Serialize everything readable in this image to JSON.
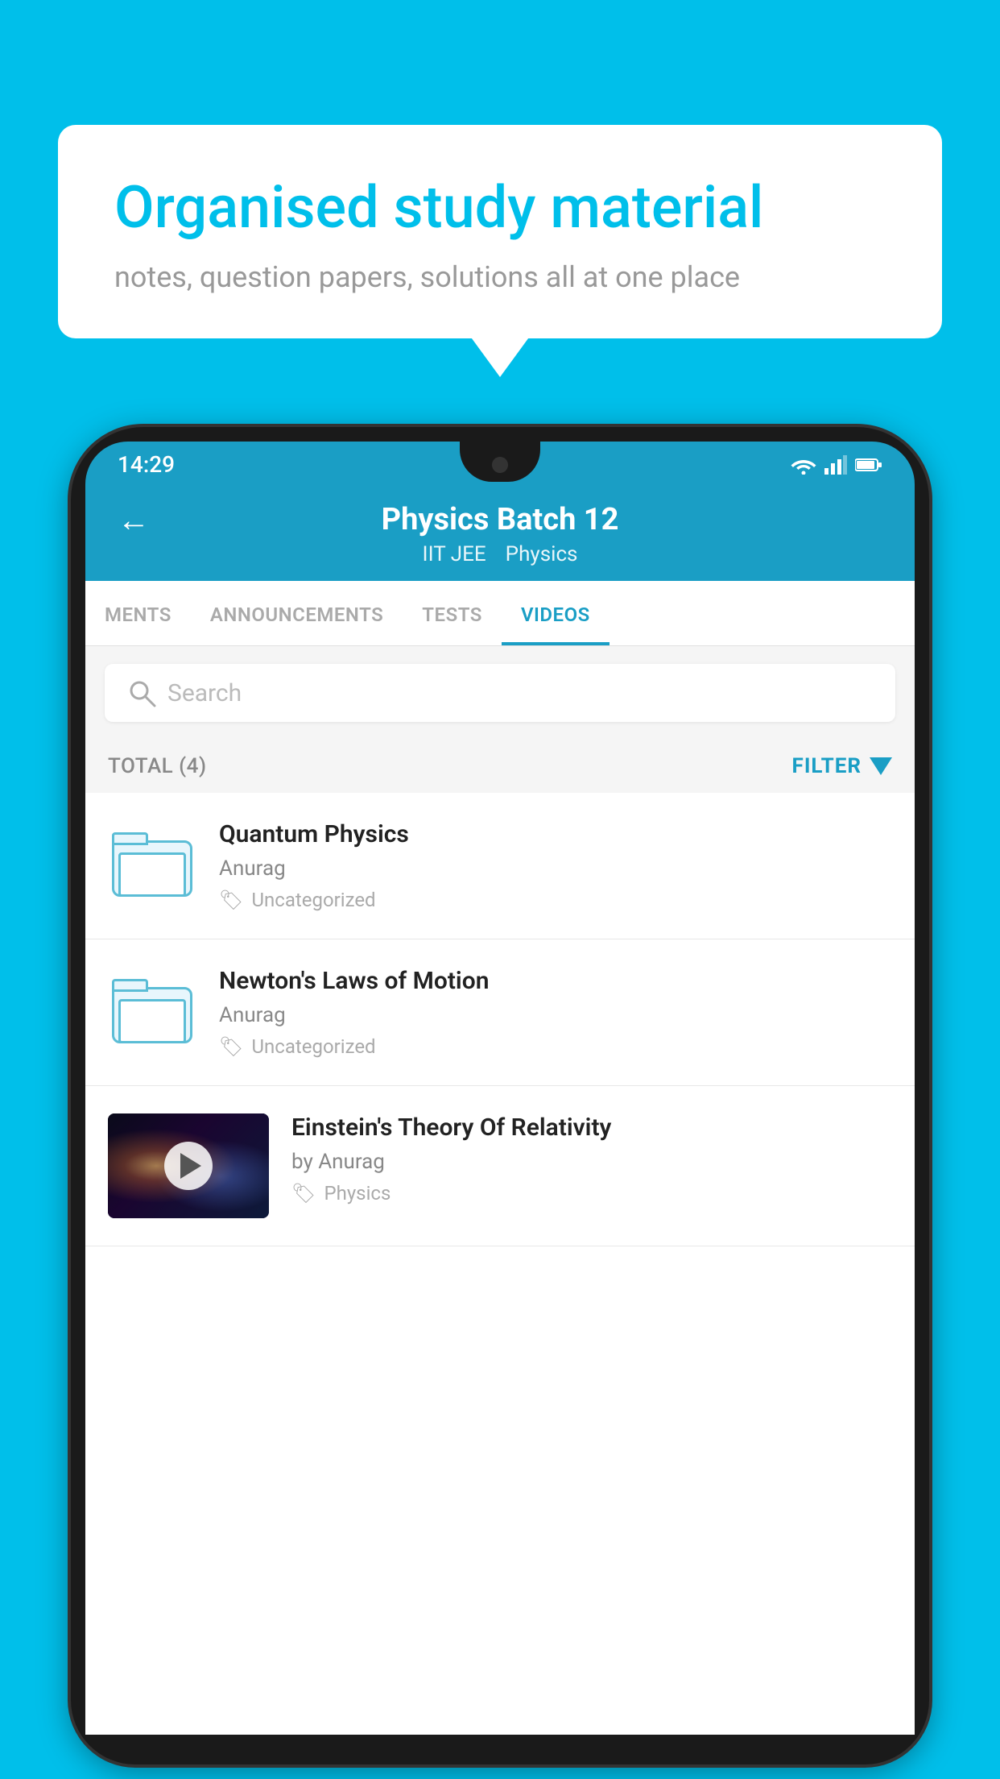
{
  "background_color": "#00BFEA",
  "speech_bubble": {
    "title": "Organised study material",
    "subtitle": "notes, question papers, solutions all at one place"
  },
  "phone": {
    "status_bar": {
      "time": "14:29"
    },
    "app_header": {
      "back_label": "←",
      "title": "Physics Batch 12",
      "tag1": "IIT JEE",
      "tag2": "Physics"
    },
    "tabs": [
      {
        "label": "MENTS",
        "active": false
      },
      {
        "label": "ANNOUNCEMENTS",
        "active": false
      },
      {
        "label": "TESTS",
        "active": false
      },
      {
        "label": "VIDEOS",
        "active": true
      }
    ],
    "search": {
      "placeholder": "Search"
    },
    "filter_bar": {
      "total_label": "TOTAL (4)",
      "filter_label": "FILTER"
    },
    "videos": [
      {
        "id": 1,
        "title": "Quantum Physics",
        "author": "Anurag",
        "tag": "Uncategorized",
        "type": "folder"
      },
      {
        "id": 2,
        "title": "Newton's Laws of Motion",
        "author": "Anurag",
        "tag": "Uncategorized",
        "type": "folder"
      },
      {
        "id": 3,
        "title": "Einstein's Theory Of Relativity",
        "author": "by Anurag",
        "tag": "Physics",
        "type": "video"
      }
    ]
  }
}
